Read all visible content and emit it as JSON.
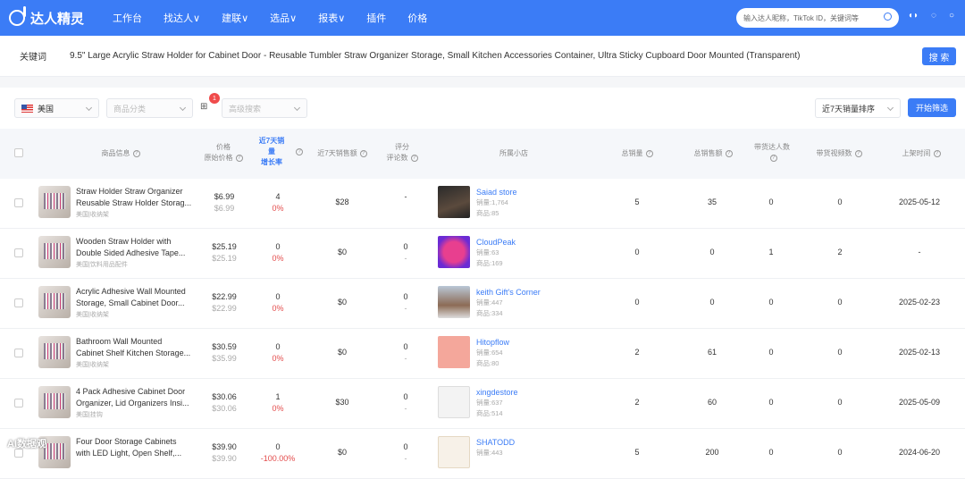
{
  "nav": {
    "logo": "达人精灵",
    "items": [
      "工作台",
      "找达人∨",
      "建联∨",
      "选品∨",
      "报表∨",
      "插件",
      "价格"
    ],
    "search_placeholder": "输入达人昵称，TikTok ID，关键词等",
    "icons": [
      "search-icon",
      "headset-icon",
      "bulb-icon",
      "user-icon"
    ]
  },
  "keyword": {
    "label": "关键词",
    "value": "9.5\"   Large Acrylic Straw Holder for Cabinet Door - Reusable Tumbler Straw Organizer Storage, Small Kitchen Accessories Container, Ultra Sticky Cupboard Door Mounted (Transparent)",
    "search_button": "搜 索"
  },
  "filters": {
    "country": "美国",
    "category_placeholder": "商品分类",
    "advanced_placeholder": "高级搜索",
    "grid_icon": "grid-icon",
    "badge_count": "1",
    "sort": "近7天销量排序",
    "start_button": "开始筛选"
  },
  "columns": {
    "product": "商品信息",
    "price": "价格",
    "orig_price": "原始价格",
    "sales7_line1": "近7天销",
    "sales7_line2": "量",
    "growth": "增长率",
    "revenue7": "近7天销售额",
    "rating": "评分",
    "reviews": "评论数",
    "shop": "所属小店",
    "total_sales": "总销量",
    "total_revenue": "总销售额",
    "influencers_line1": "带货达人数",
    "videos": "带货视频数",
    "listed": "上架时间"
  },
  "rows": [
    {
      "name1": "Straw Holder Straw Organizer",
      "name2": "Reusable Straw Holder Storag...",
      "cat": "美国|收纳架",
      "price": "$6.99",
      "orig": "$6.99",
      "sales7": "4",
      "growth": "0%",
      "rev7": "$28",
      "rating": "-",
      "reviews": "",
      "shop": "Saiad store",
      "shop_sales": "销量:1,764",
      "shop_products": "商品:85",
      "total_sales": "5",
      "total_rev": "35",
      "infl": "0",
      "videos": "0",
      "listed": "2025-05-12"
    },
    {
      "name1": "Wooden Straw Holder with",
      "name2": "Double Sided Adhesive Tape...",
      "cat": "美国|饮料用品配件",
      "price": "$25.19",
      "orig": "$25.19",
      "sales7": "0",
      "growth": "0%",
      "rev7": "$0",
      "rating": "0",
      "reviews": "-",
      "shop": "CloudPeak",
      "shop_sales": "销量:63",
      "shop_products": "商品:169",
      "total_sales": "0",
      "total_rev": "0",
      "infl": "1",
      "videos": "2",
      "listed": "-"
    },
    {
      "name1": "Acrylic Adhesive Wall Mounted",
      "name2": "Storage, Small Cabinet Door...",
      "cat": "美国|收纳架",
      "price": "$22.99",
      "orig": "$22.99",
      "sales7": "0",
      "growth": "0%",
      "rev7": "$0",
      "rating": "0",
      "reviews": "-",
      "shop": "keith Gift's Corner",
      "shop_sales": "销量:447",
      "shop_products": "商品:334",
      "total_sales": "0",
      "total_rev": "0",
      "infl": "0",
      "videos": "0",
      "listed": "2025-02-23"
    },
    {
      "name1": "Bathroom Wall Mounted",
      "name2": "Cabinet Shelf Kitchen Storage...",
      "cat": "美国|收纳架",
      "price": "$30.59",
      "orig": "$35.99",
      "sales7": "0",
      "growth": "0%",
      "rev7": "$0",
      "rating": "0",
      "reviews": "-",
      "shop": "Hitopflow",
      "shop_sales": "销量:654",
      "shop_products": "商品:80",
      "total_sales": "2",
      "total_rev": "61",
      "infl": "0",
      "videos": "0",
      "listed": "2025-02-13"
    },
    {
      "name1": "4 Pack Adhesive Cabinet Door",
      "name2": "Organizer, Lid Organizers Insi...",
      "cat": "美国|挂钩",
      "price": "$30.06",
      "orig": "$30.06",
      "sales7": "1",
      "growth": "0%",
      "rev7": "$30",
      "rating": "0",
      "reviews": "-",
      "shop": "xingdestore",
      "shop_sales": "销量:637",
      "shop_products": "商品:514",
      "total_sales": "2",
      "total_rev": "60",
      "infl": "0",
      "videos": "0",
      "listed": "2025-05-09"
    },
    {
      "name1": "Four Door Storage Cabinets",
      "name2": "with LED Light, Open Shelf,...",
      "cat": "",
      "price": "$39.90",
      "orig": "$39.90",
      "sales7": "0",
      "growth": "-100.00%",
      "rev7": "$0",
      "rating": "0",
      "reviews": "-",
      "shop": "SHATODD",
      "shop_sales": "销量:443",
      "shop_products": "",
      "total_sales": "5",
      "total_rev": "200",
      "infl": "0",
      "videos": "0",
      "listed": "2024-06-20"
    }
  ],
  "watermark": "AI数据观"
}
